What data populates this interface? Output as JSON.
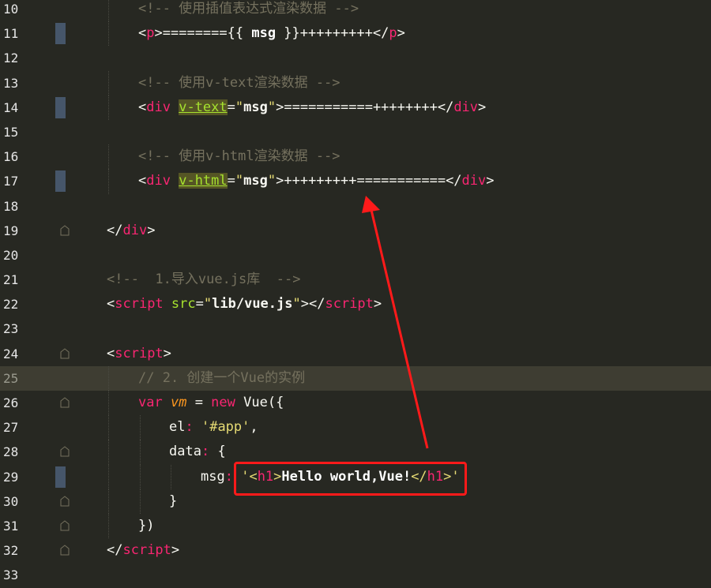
{
  "lines": [
    {
      "num": "10",
      "indent": 1,
      "parts": [
        {
          "t": "<!-- 使用插值表达式渲染数据 -->",
          "c": "c-comment"
        }
      ]
    },
    {
      "num": "11",
      "indent": 1,
      "mark": true,
      "parts": [
        {
          "t": "<",
          "c": "c-br"
        },
        {
          "t": "p",
          "c": "c-tag"
        },
        {
          "t": ">",
          "c": "c-br"
        },
        {
          "t": "========{{ ",
          "c": "c-plain"
        },
        {
          "t": "msg",
          "c": "c-bold"
        },
        {
          "t": " }}+++++++++",
          "c": "c-plain"
        },
        {
          "t": "</",
          "c": "c-br"
        },
        {
          "t": "p",
          "c": "c-tag"
        },
        {
          "t": ">",
          "c": "c-br"
        }
      ]
    },
    {
      "num": "12",
      "indent": 0,
      "parts": []
    },
    {
      "num": "13",
      "indent": 1,
      "parts": [
        {
          "t": "<!-- 使用v-text渲染数据 -->",
          "c": "c-comment"
        }
      ]
    },
    {
      "num": "14",
      "indent": 1,
      "mark": true,
      "parts": [
        {
          "t": "<",
          "c": "c-br"
        },
        {
          "t": "div",
          "c": "c-tag"
        },
        {
          "t": " ",
          "c": "c-plain"
        },
        {
          "t": "v-text",
          "c": "c-attr-hl"
        },
        {
          "t": "=",
          "c": "c-plain"
        },
        {
          "t": "\"",
          "c": "c-str"
        },
        {
          "t": "msg",
          "c": "c-str-b"
        },
        {
          "t": "\"",
          "c": "c-str"
        },
        {
          "t": ">",
          "c": "c-br"
        },
        {
          "t": "===========++++++++",
          "c": "c-plain"
        },
        {
          "t": "</",
          "c": "c-br"
        },
        {
          "t": "div",
          "c": "c-tag"
        },
        {
          "t": ">",
          "c": "c-br"
        }
      ]
    },
    {
      "num": "15",
      "indent": 0,
      "parts": []
    },
    {
      "num": "16",
      "indent": 1,
      "parts": [
        {
          "t": "<!-- 使用v-html渲染数据 -->",
          "c": "c-comment"
        }
      ]
    },
    {
      "num": "17",
      "indent": 1,
      "mark": true,
      "parts": [
        {
          "t": "<",
          "c": "c-br"
        },
        {
          "t": "div",
          "c": "c-tag"
        },
        {
          "t": " ",
          "c": "c-plain"
        },
        {
          "t": "v-html",
          "c": "c-attr-hl"
        },
        {
          "t": "=",
          "c": "c-plain"
        },
        {
          "t": "\"",
          "c": "c-str"
        },
        {
          "t": "msg",
          "c": "c-str-b"
        },
        {
          "t": "\"",
          "c": "c-str"
        },
        {
          "t": ">",
          "c": "c-br"
        },
        {
          "t": "+++++++++===========",
          "c": "c-plain"
        },
        {
          "t": "</",
          "c": "c-br"
        },
        {
          "t": "div",
          "c": "c-tag"
        },
        {
          "t": ">",
          "c": "c-br"
        }
      ]
    },
    {
      "num": "18",
      "indent": 0,
      "parts": []
    },
    {
      "num": "19",
      "indent": 0,
      "fold": true,
      "parts": [
        {
          "t": "</",
          "c": "c-br"
        },
        {
          "t": "div",
          "c": "c-tag"
        },
        {
          "t": ">",
          "c": "c-br"
        }
      ]
    },
    {
      "num": "20",
      "indent": 0,
      "parts": []
    },
    {
      "num": "21",
      "indent": 0,
      "parts": [
        {
          "t": "<!--  1.导入vue.js库  -->",
          "c": "c-comment"
        }
      ]
    },
    {
      "num": "22",
      "indent": 0,
      "parts": [
        {
          "t": "<",
          "c": "c-br"
        },
        {
          "t": "script",
          "c": "c-tag"
        },
        {
          "t": " ",
          "c": "c-plain"
        },
        {
          "t": "src",
          "c": "c-attr"
        },
        {
          "t": "=",
          "c": "c-plain"
        },
        {
          "t": "\"",
          "c": "c-str"
        },
        {
          "t": "lib/vue.js",
          "c": "c-str-b"
        },
        {
          "t": "\"",
          "c": "c-str"
        },
        {
          "t": ">",
          "c": "c-br"
        },
        {
          "t": "</",
          "c": "c-br"
        },
        {
          "t": "script",
          "c": "c-tag"
        },
        {
          "t": ">",
          "c": "c-br"
        }
      ]
    },
    {
      "num": "23",
      "indent": 0,
      "parts": []
    },
    {
      "num": "24",
      "indent": 0,
      "fold": true,
      "parts": [
        {
          "t": "<",
          "c": "c-br"
        },
        {
          "t": "script",
          "c": "c-tag"
        },
        {
          "t": ">",
          "c": "c-br"
        }
      ]
    },
    {
      "num": "25",
      "indent": 1,
      "current": true,
      "parts": [
        {
          "t": "// 2. 创建一个Vue的实例",
          "c": "c-comment"
        }
      ]
    },
    {
      "num": "26",
      "indent": 1,
      "fold": true,
      "parts": [
        {
          "t": "var",
          "c": "c-kw"
        },
        {
          "t": " ",
          "c": "c-plain"
        },
        {
          "t": "vm",
          "c": "c-var"
        },
        {
          "t": " = ",
          "c": "c-plain"
        },
        {
          "t": "new",
          "c": "c-kw"
        },
        {
          "t": " Vue({",
          "c": "c-plain"
        }
      ]
    },
    {
      "num": "27",
      "indent": 2,
      "parts": [
        {
          "t": "el",
          "c": "c-plain"
        },
        {
          "t": ": ",
          "c": "c-kw"
        },
        {
          "t": "'#app'",
          "c": "c-str"
        },
        {
          "t": ",",
          "c": "c-plain"
        }
      ]
    },
    {
      "num": "28",
      "indent": 2,
      "fold": true,
      "parts": [
        {
          "t": "data",
          "c": "c-plain"
        },
        {
          "t": ": ",
          "c": "c-kw"
        },
        {
          "t": "{",
          "c": "c-plain"
        }
      ]
    },
    {
      "num": "29",
      "indent": 3,
      "mark": true,
      "parts": [
        {
          "t": "msg",
          "c": "c-plain"
        },
        {
          "t": ": ",
          "c": "c-kw"
        },
        {
          "t": "'<",
          "c": "c-str"
        },
        {
          "t": "h1",
          "c": "c-tag"
        },
        {
          "t": ">",
          "c": "c-str"
        },
        {
          "t": "Hello world,Vue!",
          "c": "c-bold"
        },
        {
          "t": "</",
          "c": "c-str"
        },
        {
          "t": "h1",
          "c": "c-tag"
        },
        {
          "t": ">'",
          "c": "c-str"
        }
      ]
    },
    {
      "num": "30",
      "indent": 2,
      "fold": true,
      "parts": [
        {
          "t": "}",
          "c": "c-plain"
        }
      ]
    },
    {
      "num": "31",
      "indent": 1,
      "fold": true,
      "parts": [
        {
          "t": "})",
          "c": "c-plain"
        }
      ]
    },
    {
      "num": "32",
      "indent": 0,
      "fold": true,
      "parts": [
        {
          "t": "</",
          "c": "c-br"
        },
        {
          "t": "script",
          "c": "c-tag"
        },
        {
          "t": ">",
          "c": "c-br"
        }
      ]
    },
    {
      "num": "33",
      "indent": 0,
      "parts": []
    }
  ],
  "annotation": {
    "color": "#ff1a1a"
  }
}
